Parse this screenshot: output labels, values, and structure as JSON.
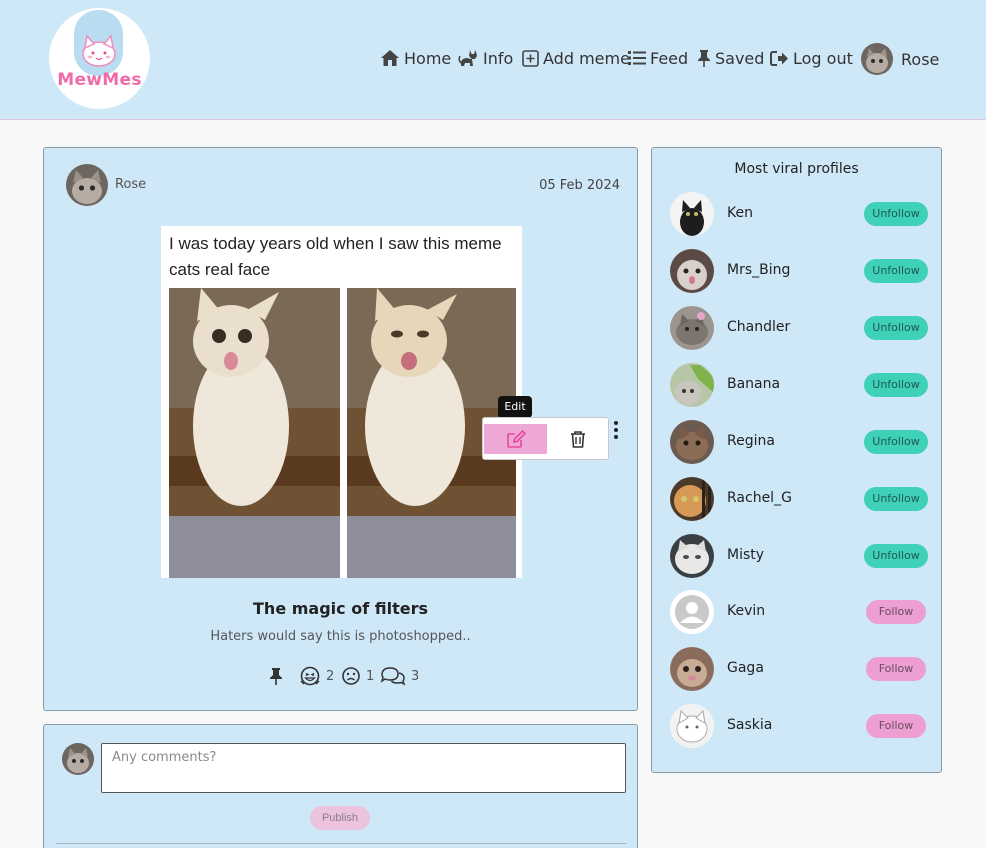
{
  "brand": {
    "name": "MewMes"
  },
  "nav": {
    "home": "Home",
    "info": "Info",
    "add_meme": "Add meme",
    "feed": "Feed",
    "saved": "Saved",
    "logout": "Log out",
    "user": "Rose"
  },
  "post": {
    "author": "Rose",
    "date": "05 Feb 2024",
    "meme_caption": "I was today years old when I saw this meme cats real face",
    "title": "The magic of filters",
    "description": "Haters would say this is photoshopped..",
    "tooltip": "Edit",
    "laugh_count": "2",
    "sad_count": "1",
    "comment_count": "3"
  },
  "comment": {
    "placeholder": "Any comments?",
    "publish": "Publish"
  },
  "sidebar": {
    "title": "Most viral profiles",
    "profiles": [
      {
        "name": "Ken",
        "button": "Unfollow"
      },
      {
        "name": "Mrs_Bing",
        "button": "Unfollow"
      },
      {
        "name": "Chandler",
        "button": "Unfollow"
      },
      {
        "name": "Banana",
        "button": "Unfollow"
      },
      {
        "name": "Regina",
        "button": "Unfollow"
      },
      {
        "name": "Rachel_G",
        "button": "Unfollow"
      },
      {
        "name": "Misty",
        "button": "Unfollow"
      },
      {
        "name": "Kevin",
        "button": "Follow"
      },
      {
        "name": "Gaga",
        "button": "Follow"
      },
      {
        "name": "Saskia",
        "button": "Follow"
      }
    ]
  },
  "colors": {
    "header_bg": "#cfe8f8",
    "accent_pink": "#f26ba8",
    "follow_button": "#ec9fd0",
    "unfollow_button": "#3fd0b8",
    "edit_highlight": "#eea8d6"
  },
  "icons": [
    "house-icon",
    "cat-icon",
    "plus-square-icon",
    "list-icon",
    "pin-icon",
    "logout-icon",
    "edit-icon",
    "trash-icon",
    "kebab-icon",
    "laugh-icon",
    "sad-icon",
    "comments-icon"
  ]
}
